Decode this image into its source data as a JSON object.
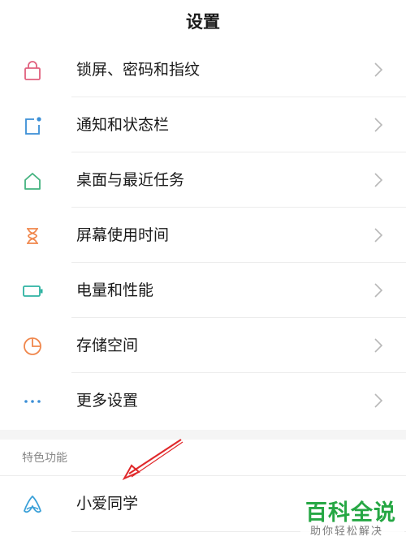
{
  "header": {
    "title": "设置"
  },
  "settings": {
    "items": [
      {
        "label": "锁屏、密码和指纹",
        "icon": "lock-icon",
        "color": "#e0607e"
      },
      {
        "label": "通知和状态栏",
        "icon": "notification-icon",
        "color": "#3b8fd6"
      },
      {
        "label": "桌面与最近任务",
        "icon": "home-icon",
        "color": "#43b27f"
      },
      {
        "label": "屏幕使用时间",
        "icon": "hourglass-icon",
        "color": "#f0874c"
      },
      {
        "label": "电量和性能",
        "icon": "battery-icon",
        "color": "#2fb3a2"
      },
      {
        "label": "存储空间",
        "icon": "pie-chart-icon",
        "color": "#f0874c"
      },
      {
        "label": "更多设置",
        "icon": "more-icon",
        "color": "#3b8fd6"
      }
    ]
  },
  "featured": {
    "section_title": "特色功能",
    "xiaoai": {
      "label": "小爱同学",
      "icon": "xiaoai-icon",
      "color": "#3aa0d8"
    }
  },
  "watermark": {
    "main": "百科全说",
    "sub": "助你轻松解决"
  },
  "annotation": {
    "arrow_color": "#e0292b"
  }
}
